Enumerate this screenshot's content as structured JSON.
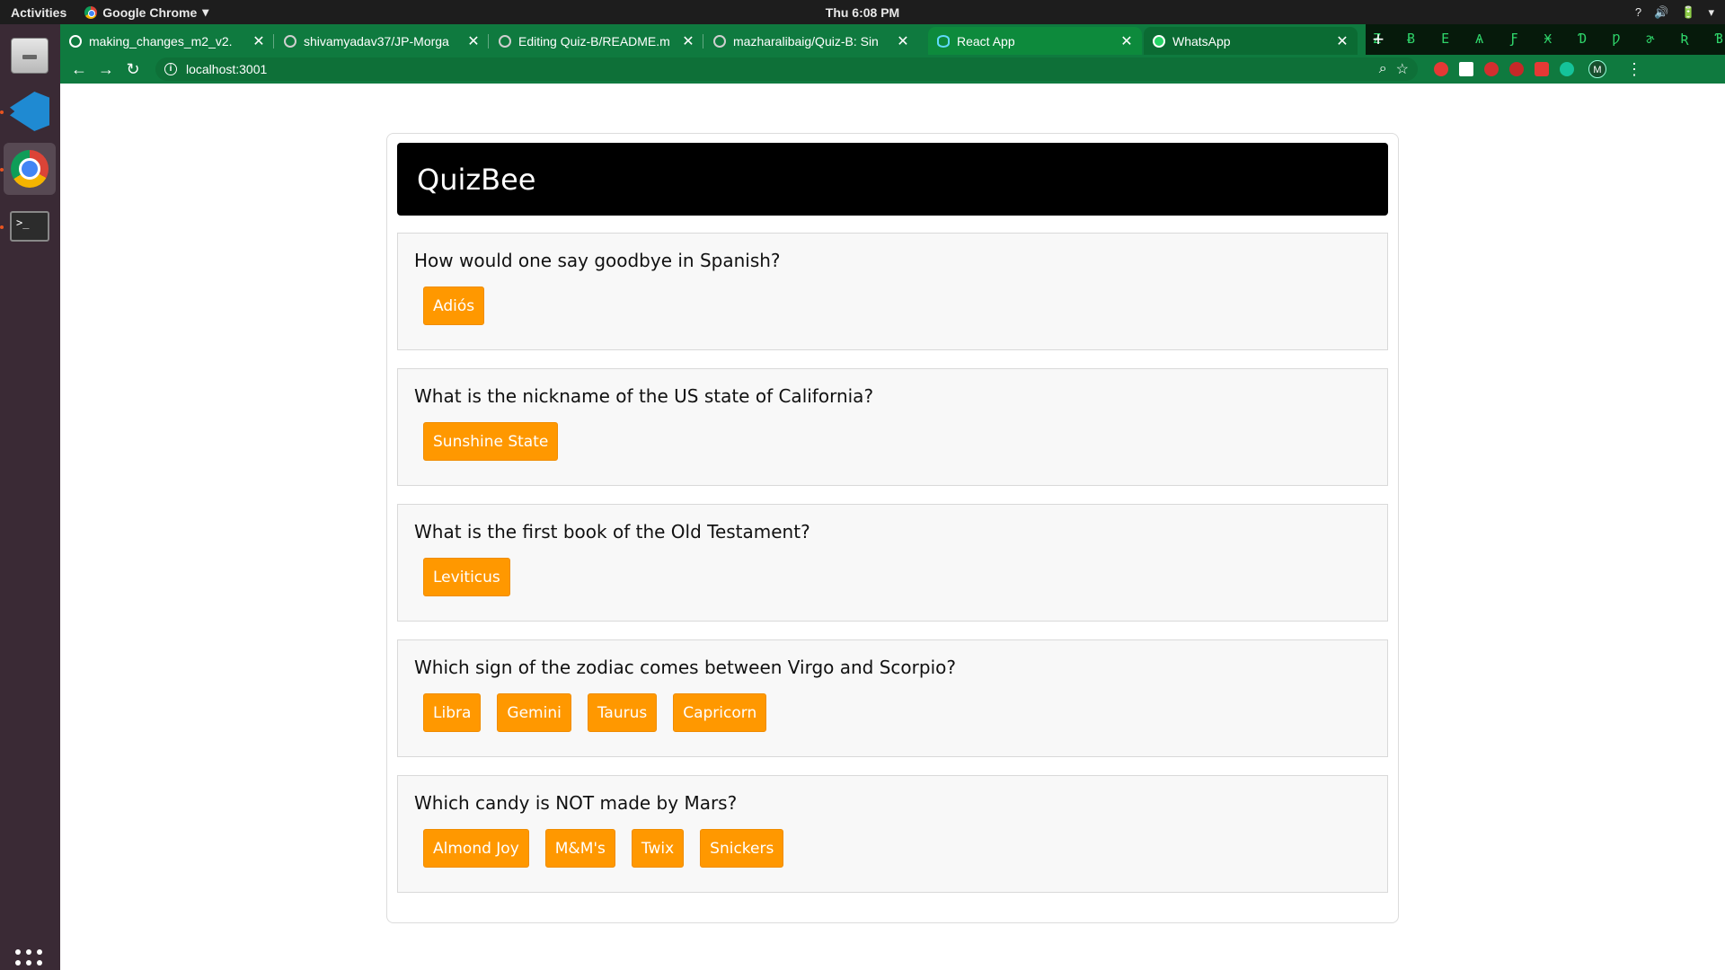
{
  "topbar": {
    "activities": "Activities",
    "app_name": "Google Chrome",
    "clock": "Thu  6:08 PM",
    "tray": [
      "?",
      "🔊",
      "🔋",
      "▾"
    ]
  },
  "browser": {
    "tabs": [
      {
        "title": "making_changes_m2_v2.",
        "favicon": "globe-icon"
      },
      {
        "title": "shivamyadav37/JP-Morga",
        "favicon": "github-icon"
      },
      {
        "title": "Editing Quiz-B/README.m",
        "favicon": "github-icon"
      },
      {
        "title": "mazharalibaig/Quiz-B: Sin",
        "favicon": "github-icon"
      },
      {
        "title": "React App",
        "favicon": "react-icon"
      },
      {
        "title": "WhatsApp",
        "favicon": "whatsapp-icon"
      }
    ],
    "new_tab": "+",
    "tab_close": "✕",
    "matrix_text": "Ƶ Ƀ E Ѧ Ƒ Ӿ Ɗ Ƿ ɚ Ʀ Ɓ",
    "url": "localhost:3001",
    "nav": {
      "back": "←",
      "forward": "→",
      "reload": "↻"
    },
    "profile_initial": "M",
    "colors": {
      "frame": "#0f7a3f",
      "matrix": "#2fd46a"
    }
  },
  "quiz": {
    "title": "QuizBee",
    "colors": {
      "answer_button": "#ff9800",
      "header": "#000000"
    },
    "questions": [
      {
        "question": "How would one say goodbye in Spanish?",
        "answers": [
          "Adiós"
        ]
      },
      {
        "question": "What is the nickname of the US state of California?",
        "answers": [
          "Sunshine State"
        ]
      },
      {
        "question": "What is the first book of the Old Testament?",
        "answers": [
          "Leviticus"
        ]
      },
      {
        "question": "Which sign of the zodiac comes between Virgo and Scorpio?",
        "answers": [
          "Libra",
          "Gemini",
          "Taurus",
          "Capricorn"
        ]
      },
      {
        "question": "Which candy is NOT made by Mars?",
        "answers": [
          "Almond Joy",
          "M&M's",
          "Twix",
          "Snickers"
        ]
      }
    ]
  }
}
